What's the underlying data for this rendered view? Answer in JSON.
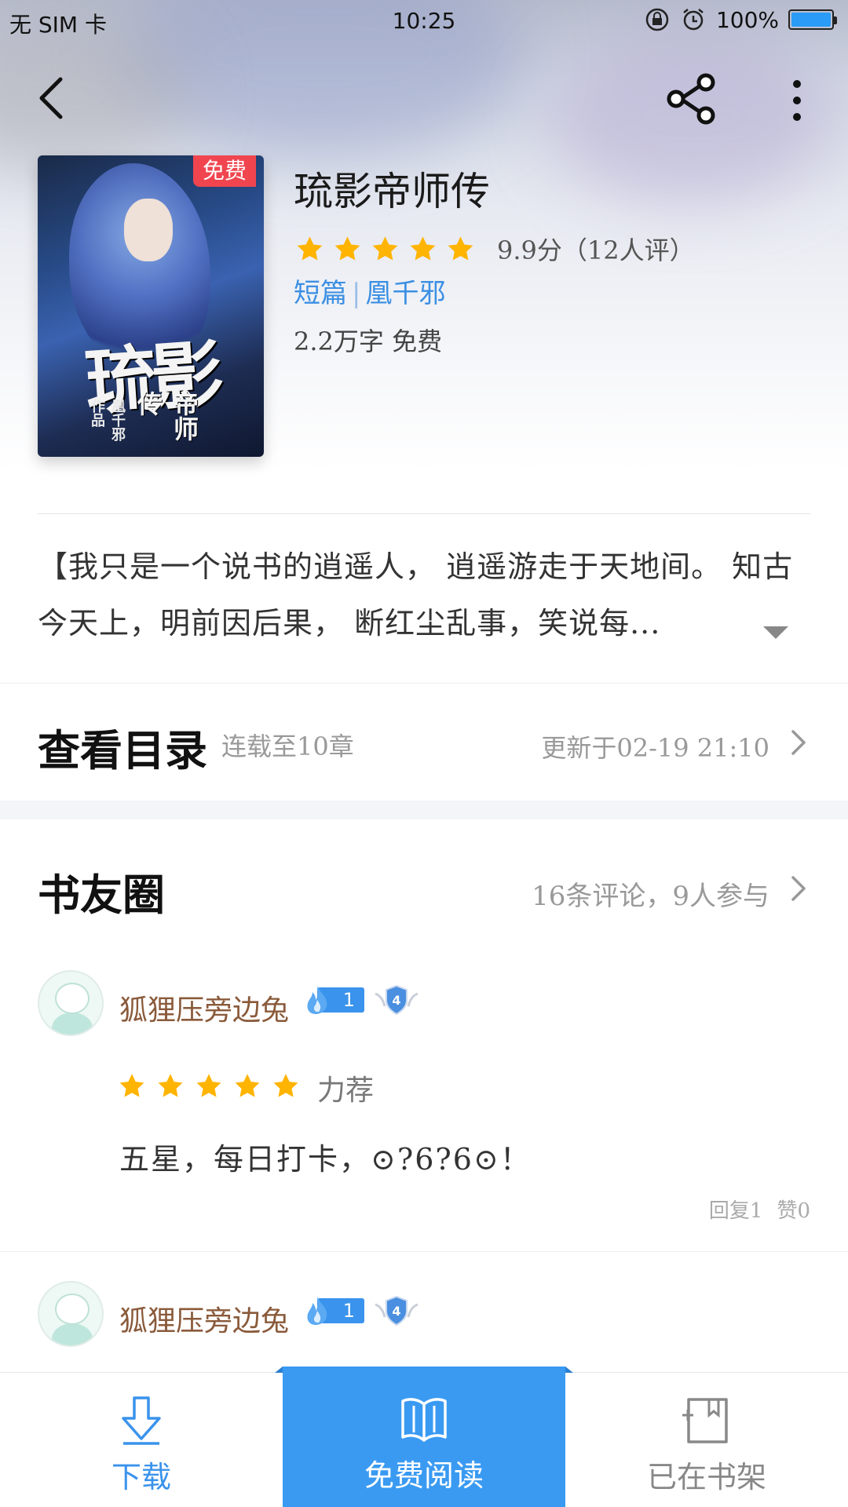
{
  "status_bar": {
    "carrier": "无 SIM 卡",
    "time": "10:25",
    "battery": "100%"
  },
  "book": {
    "title": "琉影帝师传",
    "cover_tag": "免费",
    "cover_title": "琉影",
    "cover_subtitle": "帝师传",
    "cover_author": "凰千邪 作品",
    "rating_stars": 5,
    "rating_text": "9.9分（12人评）",
    "category": "短篇",
    "meta_separator": "|",
    "author": "凰千邪",
    "word_count": "2.2万字",
    "price": "免费"
  },
  "synopsis": "【我只是一个说书的逍遥人， 逍遥游走于天地间。 知古今天上，明前因后果， 断红尘乱事，笑说每...",
  "catalog": {
    "title": "查看目录",
    "progress": "连载至10章",
    "updated": "更新于02-19 21:10"
  },
  "circle": {
    "title": "书友圈",
    "summary": "16条评论，9人参与"
  },
  "comments": [
    {
      "username": "狐狸压旁边兔",
      "level": "1",
      "vip_level": "4",
      "stars": 5,
      "rating_label": "力荐",
      "text": "五星，每日打卡，⊙?6?6⊙！",
      "replies": "回复1",
      "likes": "赞0"
    },
    {
      "username": "狐狸压旁边兔",
      "level": "1",
      "vip_level": "4"
    }
  ],
  "bottom_bar": {
    "download": "下载",
    "read": "免费阅读",
    "shelf": "已在书架"
  },
  "colors": {
    "accent_blue": "#3a9af2",
    "star_yellow": "#ffb400",
    "free_tag_red": "#f0454f",
    "username_brown": "#8a5a3a"
  }
}
